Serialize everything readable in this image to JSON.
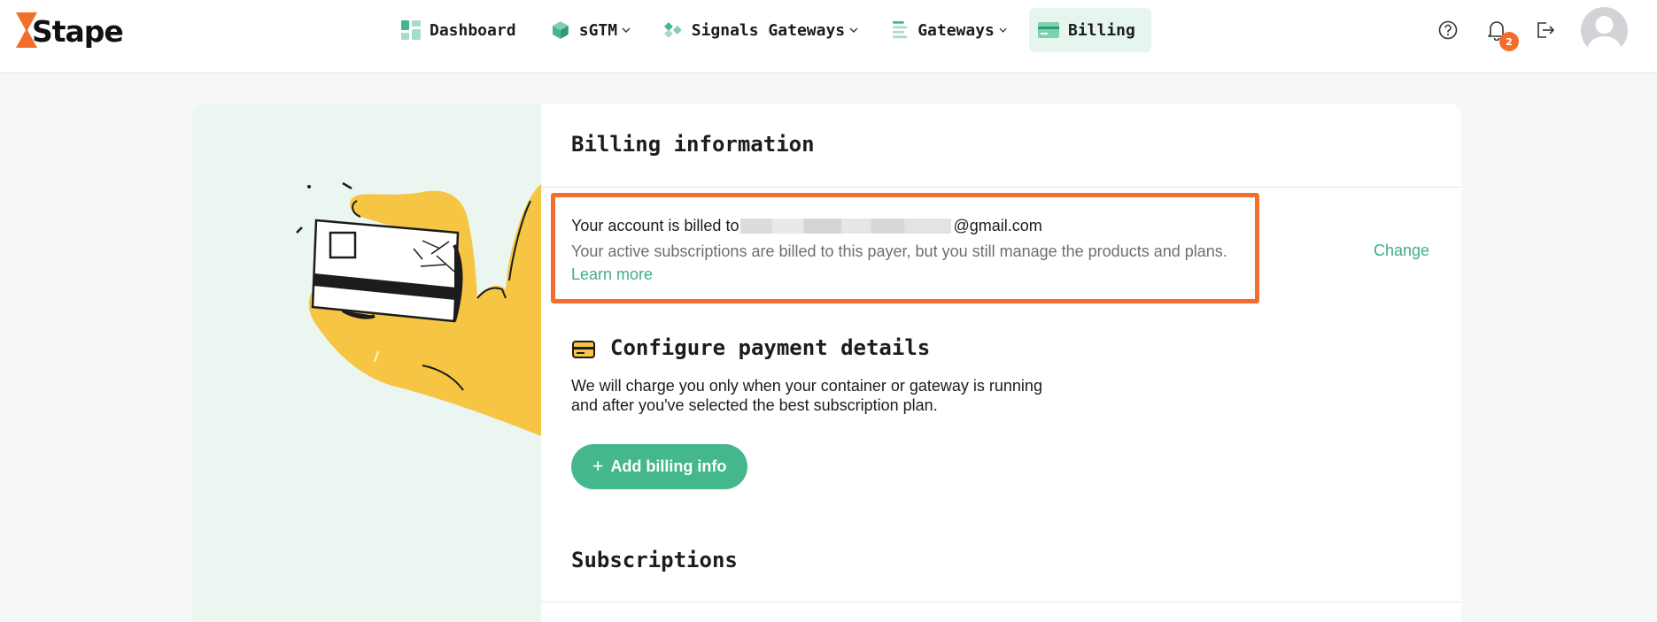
{
  "brand": {
    "name": "Stape",
    "accent": "#f36e2c",
    "green": "#44b88c"
  },
  "nav": {
    "items": [
      {
        "label": "Dashboard",
        "icon": "dashboard-icon",
        "has_dropdown": false,
        "active": false
      },
      {
        "label": "sGTM",
        "icon": "cube-icon",
        "has_dropdown": true,
        "active": false
      },
      {
        "label": "Signals Gateways",
        "icon": "signals-icon",
        "has_dropdown": true,
        "active": false
      },
      {
        "label": "Gateways",
        "icon": "gateways-icon",
        "has_dropdown": true,
        "active": false
      },
      {
        "label": "Billing",
        "icon": "billing-card-icon",
        "has_dropdown": false,
        "active": true
      }
    ]
  },
  "header": {
    "icons": [
      "help-icon",
      "bell-icon",
      "logout-icon"
    ],
    "notification_count": "2"
  },
  "billing": {
    "title": "Billing information",
    "billed_prefix": "Your account is billed to",
    "billed_suffix": "@gmail.com",
    "description": "Your active subscriptions are billed to this payer, but you still manage the products and plans.",
    "learn_more": "Learn more",
    "change": "Change"
  },
  "payment": {
    "title": "Configure payment details",
    "description_line1": "We will charge you only when your container or gateway is running",
    "description_line2": "and after you've selected the best subscription plan.",
    "button_label": "Add billing info"
  },
  "subscriptions": {
    "title": "Subscriptions"
  }
}
